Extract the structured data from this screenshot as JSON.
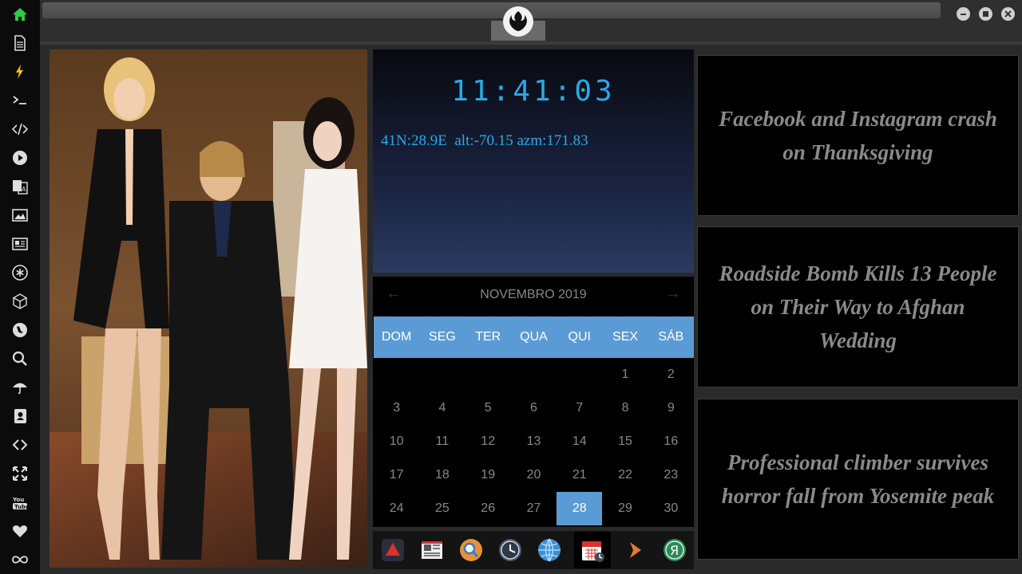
{
  "sidebar": {
    "icons": [
      "home-icon",
      "document-icon",
      "lightning-icon",
      "terminal-icon",
      "code-icon",
      "play-icon",
      "translate-icon",
      "image-icon",
      "news-icon",
      "settings-asterisk-icon",
      "cube-icon",
      "globe-icon",
      "search-icon",
      "umbrella-icon",
      "contacts-icon",
      "link-icon",
      "expand-icon",
      "youtube-icon",
      "heart-icon",
      "infinity-icon"
    ]
  },
  "clock": {
    "time": "11:41:03",
    "coords": "41N:28.9E  alt:-70.15 azm:171.83"
  },
  "calendar": {
    "month_label": "NOVEMBRO 2019",
    "weekdays": [
      "DOM",
      "SEG",
      "TER",
      "QUA",
      "QUI",
      "SEX",
      "SÁB"
    ],
    "weeks": [
      [
        "",
        "",
        "",
        "",
        "",
        "1",
        "2"
      ],
      [
        "3",
        "4",
        "5",
        "6",
        "7",
        "8",
        "9"
      ],
      [
        "10",
        "11",
        "12",
        "13",
        "14",
        "15",
        "16"
      ],
      [
        "17",
        "18",
        "19",
        "20",
        "21",
        "22",
        "23"
      ],
      [
        "24",
        "25",
        "26",
        "27",
        "28",
        "29",
        "30"
      ]
    ],
    "today": "28"
  },
  "dock": {
    "icons": [
      "app-launcher-icon",
      "news-app-icon",
      "search-app-icon",
      "clock-app-icon",
      "globe-app-icon",
      "calendar-app-icon",
      "arrow-app-icon",
      "yandex-app-icon"
    ]
  },
  "news": {
    "items": [
      "Facebook and Instagram crash on Thanksgiving",
      "Roadside Bomb Kills 13 People on Their Way to Afghan Wedding",
      "Professional climber survives horror fall from Yosemite peak"
    ]
  },
  "colors": {
    "accent": "#5b9bd5",
    "clock": "#2aa9e6"
  }
}
